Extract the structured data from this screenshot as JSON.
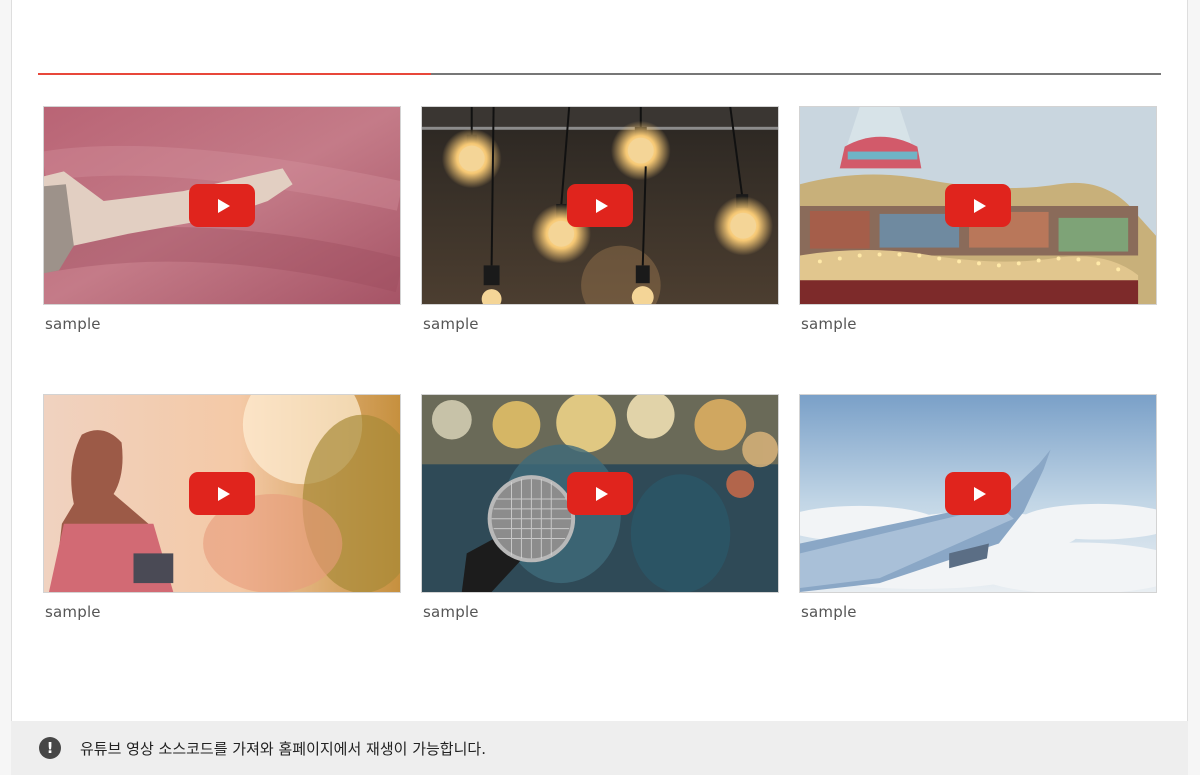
{
  "videos": [
    {
      "caption": "sample",
      "scene": "pink-grass-hand"
    },
    {
      "caption": "sample",
      "scene": "hanging-light-bulbs"
    },
    {
      "caption": "sample",
      "scene": "carousel"
    },
    {
      "caption": "sample",
      "scene": "woman-sunlight"
    },
    {
      "caption": "sample",
      "scene": "microphone-bokeh"
    },
    {
      "caption": "sample",
      "scene": "airplane-wing-clouds"
    }
  ],
  "play_icon": "youtube-play-icon",
  "colors": {
    "accent_line": "#e8473a",
    "play_button": "#e0241d"
  },
  "notice": {
    "icon": "exclamation-circle-icon",
    "text": "유튜브 영상 소스코드를 가져와 홈페이지에서 재생이 가능합니다."
  }
}
